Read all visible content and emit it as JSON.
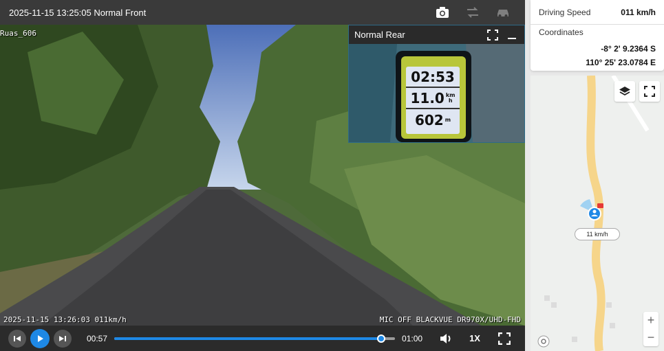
{
  "topbar": {
    "title": "2025-11-15 13:25:05 Normal Front",
    "icons": [
      "camera-icon",
      "swap-icon",
      "car-icon"
    ]
  },
  "video": {
    "channel_tag": "Ruas_606",
    "osd_left": "2025-11-15 13:26:03 011km/h",
    "osd_right": "MIC OFF BLACKVUE DR970X/UHD-FHD"
  },
  "pip": {
    "title": "Normal Rear",
    "gps_display": {
      "time": "02:53",
      "speed": "11.0",
      "speed_unit_top": "km",
      "speed_unit_bottom": "h",
      "distance": "602",
      "distance_unit": "m"
    }
  },
  "controls": {
    "current_time": "00:57",
    "end_time": "01:00",
    "progress_fraction": 0.95,
    "speed_label": "1X"
  },
  "info": {
    "speed_label": "Driving Speed",
    "speed_value": "011 km/h",
    "coords_label": "Coordinates",
    "latitude": "-8° 2' 9.2364 S",
    "longitude": "110° 25' 23.0784 E"
  },
  "map": {
    "speed_chip": "11 km/h",
    "zoom_in": "+",
    "zoom_out": "−"
  },
  "colors": {
    "accent": "#1e88e5",
    "road": "#f6d58a",
    "topbar": "#3a3a3a"
  }
}
